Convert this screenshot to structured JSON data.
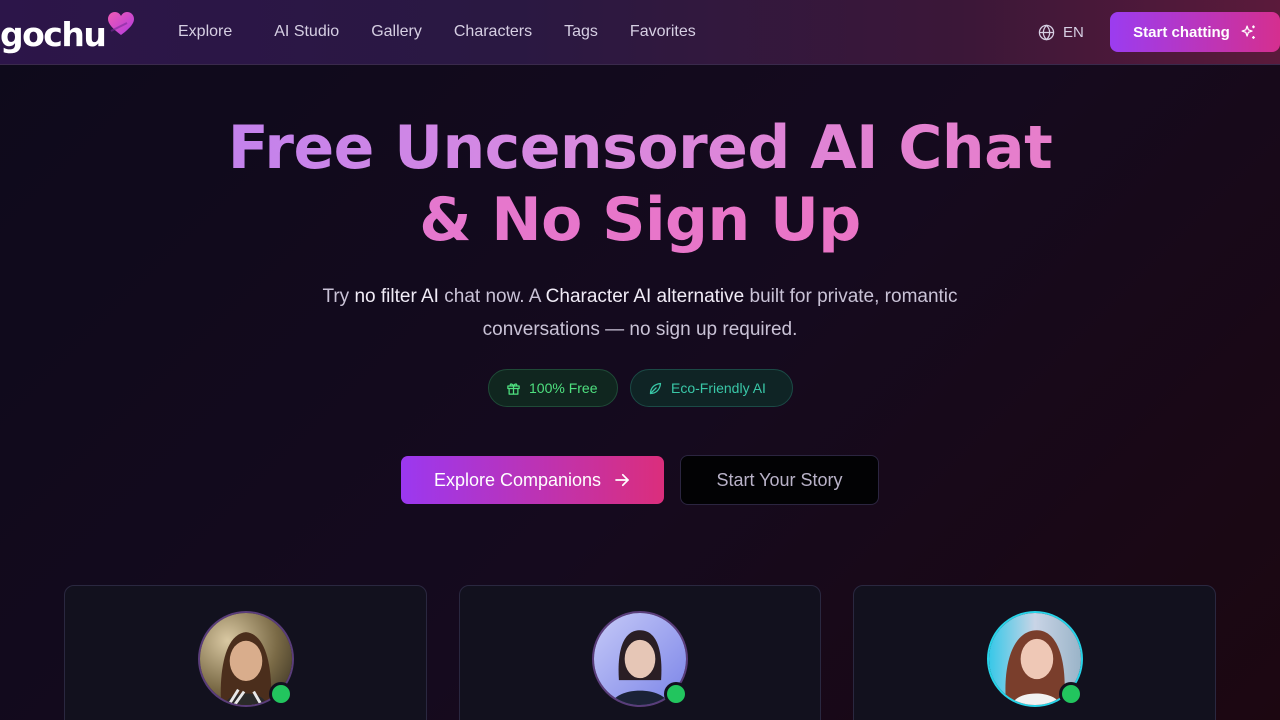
{
  "brand": {
    "name": "gochu"
  },
  "nav": {
    "links": [
      "Explore",
      "AI Studio",
      "Gallery",
      "Characters",
      "Tags",
      "Favorites"
    ],
    "language": "EN",
    "cta": "Start chatting"
  },
  "hero": {
    "title_line1": "Free Uncensored AI Chat",
    "title_line2": "& No Sign Up",
    "subtitle": {
      "part1": "Try ",
      "bold1": "no filter AI",
      "part2": " chat now. A ",
      "bold2": "Character AI alternative",
      "part3": " built for private, romantic conversations — no sign up required."
    },
    "badges": [
      "100% Free",
      "Eco-Friendly AI"
    ],
    "primary_button": "Explore Companions",
    "secondary_button": "Start Your Story"
  },
  "cards": [
    {
      "status": "online"
    },
    {
      "status": "online"
    },
    {
      "status": "online"
    }
  ],
  "colors": {
    "accent_purple": "#9b3cf0",
    "accent_pink": "#d52f8f",
    "online_green": "#22c55e",
    "badge_green": "#4ee07f",
    "badge_teal": "#39c7a7"
  },
  "icons": [
    "heart-icon",
    "globe-icon",
    "sparkles-icon",
    "gift-icon",
    "leaf-icon",
    "arrow-right-icon"
  ]
}
